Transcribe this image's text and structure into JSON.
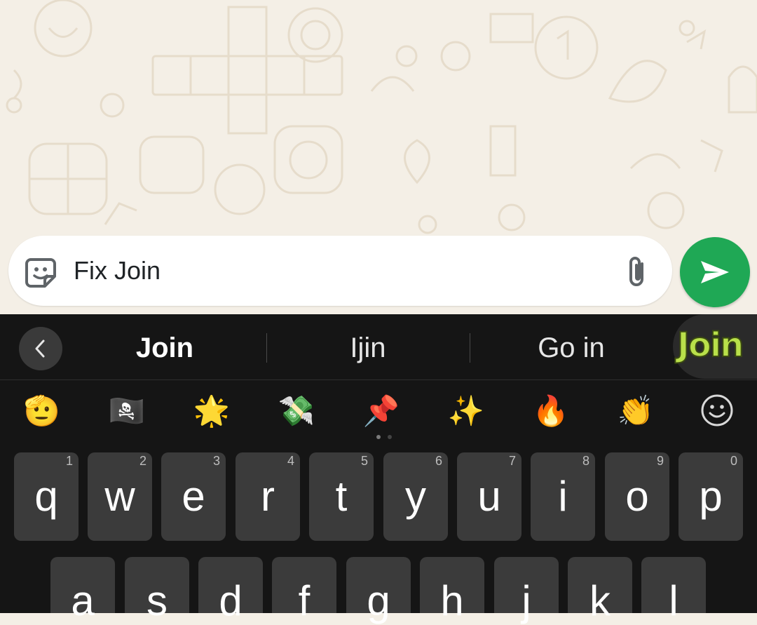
{
  "composer": {
    "text": "Fix Join",
    "sticker_icon": "sticker-icon",
    "attach_icon": "paperclip-icon"
  },
  "send_button": {
    "icon": "send-arrow-icon",
    "color": "#1fa855"
  },
  "keyboard": {
    "suggestions": [
      "Join",
      "Ijin",
      "Go in"
    ],
    "sticker_suggestion": "Join",
    "back_icon": "chevron-left-icon",
    "emoji_suggestions": [
      "🫡",
      "🏴‍☠️",
      "🌟",
      "💸",
      "📌",
      "✨",
      "🔥",
      "👏"
    ],
    "emoji_panel_icon": "smiley-face-icon",
    "row1": [
      {
        "key": "q",
        "hint": "1"
      },
      {
        "key": "w",
        "hint": "2"
      },
      {
        "key": "e",
        "hint": "3"
      },
      {
        "key": "r",
        "hint": "4"
      },
      {
        "key": "t",
        "hint": "5"
      },
      {
        "key": "y",
        "hint": "6"
      },
      {
        "key": "u",
        "hint": "7"
      },
      {
        "key": "i",
        "hint": "8"
      },
      {
        "key": "o",
        "hint": "9"
      },
      {
        "key": "p",
        "hint": "0"
      }
    ],
    "row2": [
      "a",
      "s",
      "d",
      "f",
      "g",
      "h",
      "j",
      "k",
      "l"
    ]
  },
  "colors": {
    "chat_background": "#f4efe6",
    "keyboard_background": "#151515",
    "key_background": "#3b3b3b"
  }
}
